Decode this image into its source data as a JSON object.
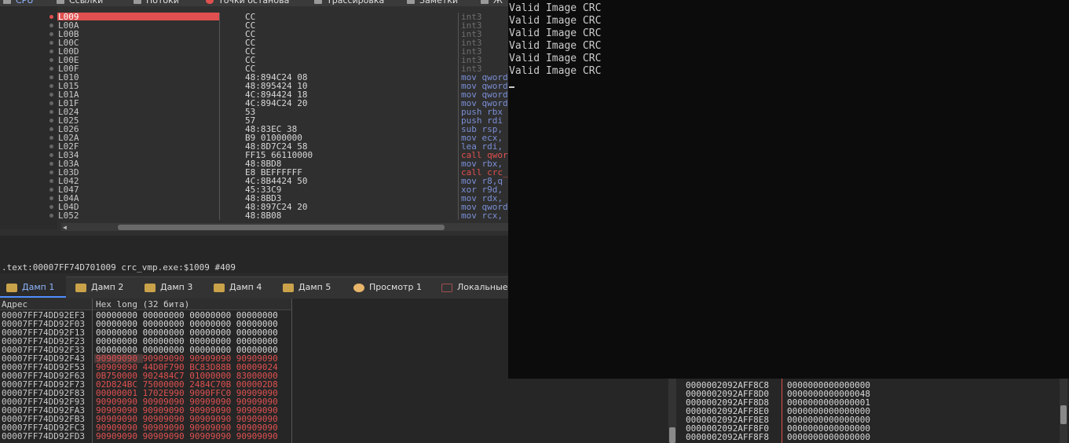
{
  "top_tabs": [
    {
      "label": "CPU",
      "active": true
    },
    {
      "label": "Ссылки"
    },
    {
      "label": "Потоки"
    },
    {
      "label": "Точки останова"
    },
    {
      "label": "Трассировка"
    },
    {
      "label": "Заметки"
    },
    {
      "label": "Ж"
    }
  ],
  "cpu": {
    "selected_address": "L009",
    "rows": [
      {
        "addr": "L009",
        "hex": "CC",
        "asm": "int3",
        "style": "gray"
      },
      {
        "addr": "L00A",
        "hex": "CC",
        "asm": "int3",
        "style": "gray"
      },
      {
        "addr": "L00B",
        "hex": "CC",
        "asm": "int3",
        "style": "gray"
      },
      {
        "addr": "L00C",
        "hex": "CC",
        "asm": "int3",
        "style": "gray"
      },
      {
        "addr": "L00D",
        "hex": "CC",
        "asm": "int3",
        "style": "gray"
      },
      {
        "addr": "L00E",
        "hex": "CC",
        "asm": "int3",
        "style": "gray"
      },
      {
        "addr": "L00F",
        "hex": "CC",
        "asm": "int3",
        "style": "gray"
      },
      {
        "addr": "L010",
        "hex": "48:894C24 08",
        "asm": "mov qword",
        "style": "normal"
      },
      {
        "addr": "L015",
        "hex": "48:895424 10",
        "asm": "mov qword",
        "style": "normal"
      },
      {
        "addr": "L01A",
        "hex": "4C:894424 18",
        "asm": "mov qword",
        "style": "normal"
      },
      {
        "addr": "L01F",
        "hex": "4C:894C24 20",
        "asm": "mov qword",
        "style": "normal"
      },
      {
        "addr": "L024",
        "hex": "53",
        "asm": "push rbx",
        "style": "normal"
      },
      {
        "addr": "L025",
        "hex": "57",
        "asm": "push rdi",
        "style": "normal"
      },
      {
        "addr": "L026",
        "hex": "48:83EC 38",
        "asm": "sub rsp,",
        "style": "normal"
      },
      {
        "addr": "L02A",
        "hex": "B9 01000000",
        "asm": "mov ecx,",
        "style": "normal"
      },
      {
        "addr": "L02F",
        "hex": "48:8D7C24 58",
        "asm": "lea rdi,",
        "style": "normal"
      },
      {
        "addr": "L034",
        "hex": "FF15 66110000",
        "asm": "call qwor",
        "style": "call"
      },
      {
        "addr": "L03A",
        "hex": "48:8BD8",
        "asm": "mov rbx,",
        "style": "normal"
      },
      {
        "addr": "L03D",
        "hex": "E8 BEFFFFFF",
        "asm": "call crc_",
        "style": "call"
      },
      {
        "addr": "L042",
        "hex": "4C:8B4424 50",
        "asm": "mov r8,q",
        "style": "normal"
      },
      {
        "addr": "L047",
        "hex": "45:33C9",
        "asm": "xor r9d,",
        "style": "normal"
      },
      {
        "addr": "L04A",
        "hex": "48:8BD3",
        "asm": "mov rdx,",
        "style": "normal"
      },
      {
        "addr": "L04D",
        "hex": "48:897C24 20",
        "asm": "mov qword",
        "style": "normal"
      },
      {
        "addr": "L052",
        "hex": "48:8B08",
        "asm": "mov rcx,",
        "style": "normal"
      }
    ],
    "info_line": ".text:00007FF74D701009 crc_vmp.exe:$1009 #409"
  },
  "dump_tabs": [
    {
      "label": "Дамп 1",
      "icon": "dump-icon",
      "active": true
    },
    {
      "label": "Дамп 2",
      "icon": "dump-icon"
    },
    {
      "label": "Дамп 3",
      "icon": "dump-icon"
    },
    {
      "label": "Дамп 4",
      "icon": "dump-icon"
    },
    {
      "label": "Дамп 5",
      "icon": "dump-icon"
    },
    {
      "label": "Просмотр 1",
      "icon": "watch-icon"
    },
    {
      "label": "Локальные",
      "icon": "locals-icon"
    }
  ],
  "dump": {
    "col_address": "Адрес",
    "col_hex": "Hex long (32 бита)",
    "rows": [
      {
        "addr": "00007FF74DD92EF3",
        "vals": "00000000 00000000 00000000 00000000",
        "color": "white"
      },
      {
        "addr": "00007FF74DD92F03",
        "vals": "00000000 00000000 00000000 00000000",
        "color": "white"
      },
      {
        "addr": "00007FF74DD92F13",
        "vals": "00000000 00000000 00000000 00000000",
        "color": "white"
      },
      {
        "addr": "00007FF74DD92F23",
        "vals": "00000000 00000000 00000000 00000000",
        "color": "white"
      },
      {
        "addr": "00007FF74DD92F33",
        "vals": "00000000 00000000 00000000 00000000",
        "color": "white"
      },
      {
        "addr": "00007FF74DD92F43",
        "vals": "90909090 90909090 90909090 90909090",
        "color": "red"
      },
      {
        "addr": "00007FF74DD92F53",
        "vals": "90909090 44D0F790 BC83D88B 00009024",
        "color": "red"
      },
      {
        "addr": "00007FF74DD92F63",
        "vals": "0B750000 902484C7 01000000 83000000",
        "color": "red"
      },
      {
        "addr": "00007FF74DD92F73",
        "vals": "02D824BC 75000000 2484C70B 000002D8",
        "color": "red"
      },
      {
        "addr": "00007FF74DD92F83",
        "vals": "00000001 1702E990 9090FFC0 90909090",
        "color": "red"
      },
      {
        "addr": "00007FF74DD92F93",
        "vals": "90909090 90909090 90909090 90909090",
        "color": "red"
      },
      {
        "addr": "00007FF74DD92FA3",
        "vals": "90909090 90909090 90909090 90909090",
        "color": "red"
      },
      {
        "addr": "00007FF74DD92FB3",
        "vals": "90909090 90909090 90909090 90909090",
        "color": "red"
      },
      {
        "addr": "00007FF74DD92FC3",
        "vals": "90909090 90909090 90909090 90909090",
        "color": "red"
      },
      {
        "addr": "00007FF74DD92FD3",
        "vals": "90909090 90909090 90909090 90909090",
        "color": "red"
      }
    ]
  },
  "stack": {
    "rows": [
      {
        "addr": "0000002092AFF8C8",
        "val": "0000000000000000"
      },
      {
        "addr": "0000002092AFF8D0",
        "val": "0000000000000048"
      },
      {
        "addr": "0000002092AFF8D8",
        "val": "0000000000000001"
      },
      {
        "addr": "0000002092AFF8E0",
        "val": "0000000000000000"
      },
      {
        "addr": "0000002092AFF8E8",
        "val": "0000000000000000"
      },
      {
        "addr": "0000002092AFF8F0",
        "val": "0000000000000000"
      },
      {
        "addr": "0000002092AFF8F8",
        "val": "0000000000000000"
      }
    ]
  },
  "console": {
    "lines": [
      "Valid Image CRC",
      "Valid Image CRC",
      "Valid Image CRC",
      "Valid Image CRC",
      "Valid Image CRC",
      "Valid Image CRC"
    ]
  }
}
